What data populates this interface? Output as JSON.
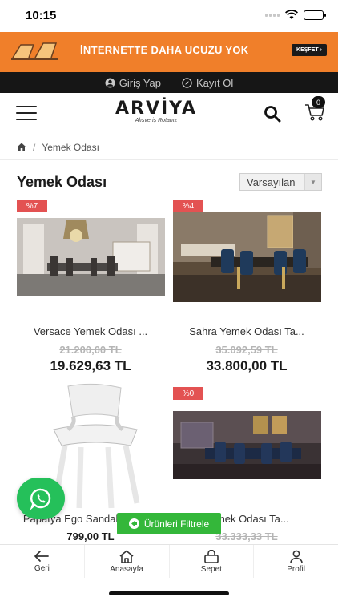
{
  "status_bar": {
    "time": "10:15"
  },
  "promo": {
    "text": "İNTERNETTE DAHA UCUZU YOK",
    "button_label": "KEŞFET"
  },
  "account": {
    "login_label": "Giriş Yap",
    "register_label": "Kayıt Ol"
  },
  "header": {
    "logo": "ARVİYA",
    "tagline": "Alışveriş Rotanız",
    "cart_count": "0"
  },
  "breadcrumb": {
    "current": "Yemek Odası"
  },
  "page": {
    "title": "Yemek Odası",
    "sort_value": "Varsayılan"
  },
  "products": [
    {
      "discount": "%7",
      "name": "Versace Yemek Odası ...",
      "old_price": "21.200,00 TL",
      "price": "19.629,63 TL"
    },
    {
      "discount": "%4",
      "name": "Sahra Yemek Odası Ta...",
      "old_price": "35.092,59 TL",
      "price": "33.800,00 TL"
    },
    {
      "discount": "",
      "name": "Papatya Ego Sandalye",
      "old_price": "",
      "price": "799,00 TL"
    },
    {
      "discount": "%0",
      "name": "Yemek Odası Ta...",
      "old_price": "33.333,33 TL",
      "price": ""
    }
  ],
  "filter": {
    "label": "Ürünleri Filtrele"
  },
  "bottom_nav": [
    {
      "label": "Geri",
      "icon": "back-arrow-icon"
    },
    {
      "label": "Anasayfa",
      "icon": "home-icon"
    },
    {
      "label": "Sepet",
      "icon": "basket-icon"
    },
    {
      "label": "Profil",
      "icon": "user-icon"
    }
  ],
  "colors": {
    "promo": "#f07f2a",
    "discount": "#e35252",
    "filter": "#34b73a",
    "whatsapp": "#25c05a",
    "account_bar": "#161616"
  }
}
